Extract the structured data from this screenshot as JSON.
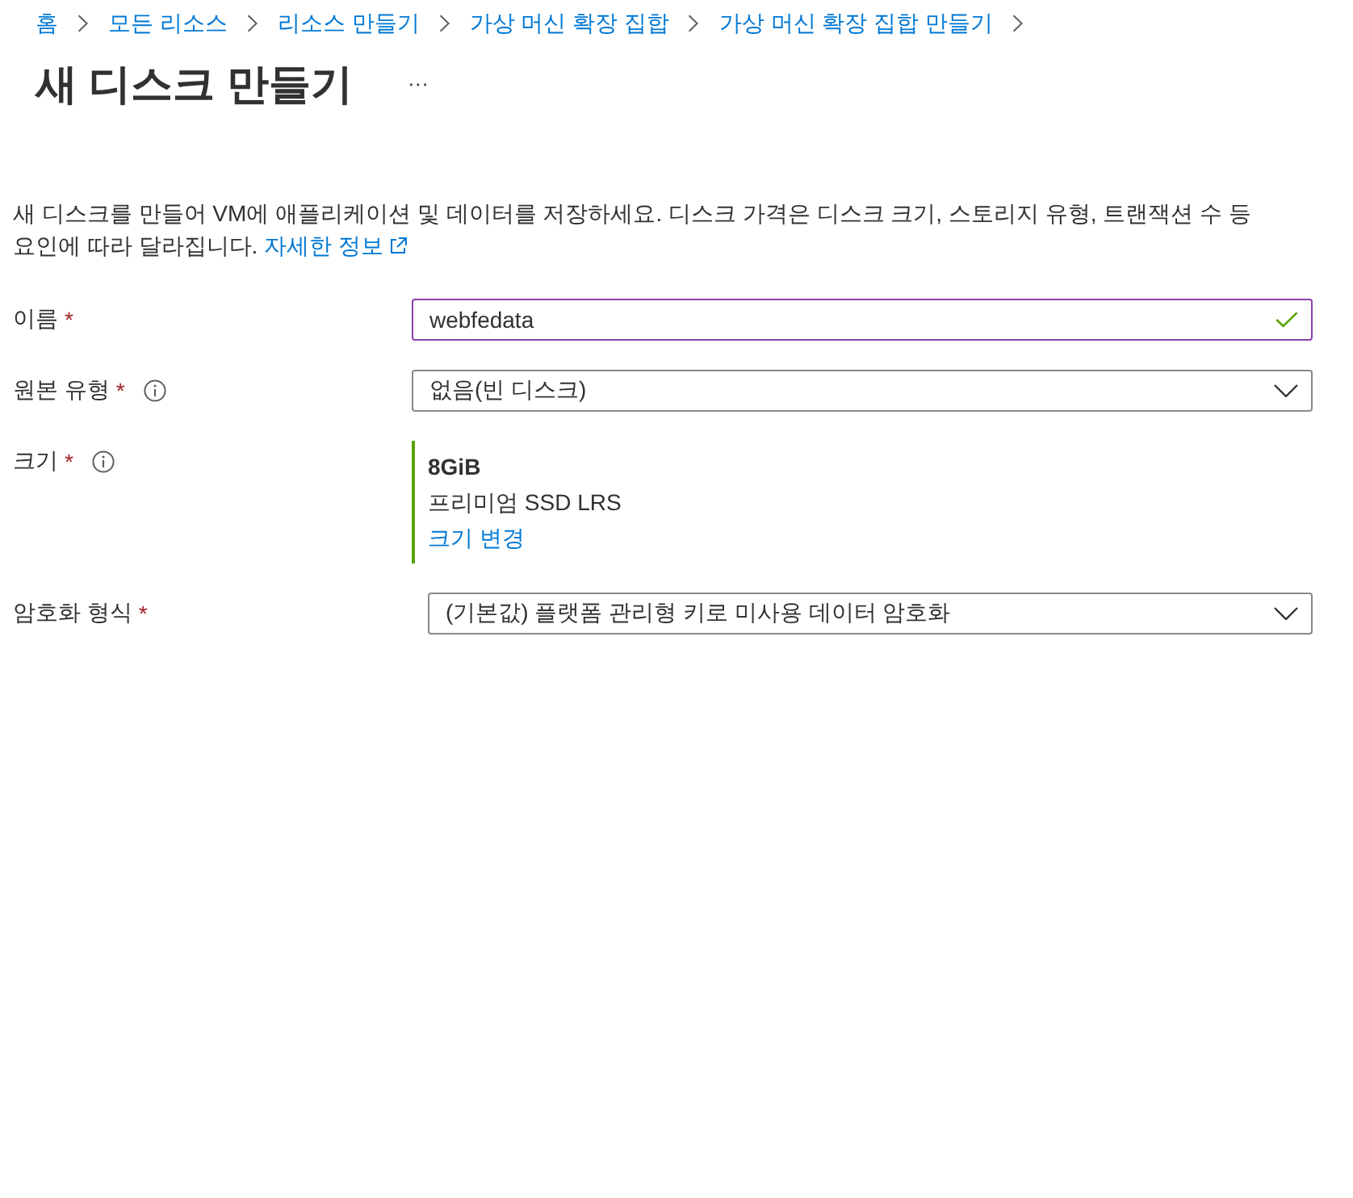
{
  "breadcrumb": [
    {
      "label": "홈"
    },
    {
      "label": "모든 리소스"
    },
    {
      "label": "리소스 만들기"
    },
    {
      "label": "가상 머신 확장 집합"
    },
    {
      "label": "가상 머신 확장 집합 만들기"
    }
  ],
  "title": "새 디스크 만들기",
  "more_button": "···",
  "description": {
    "text": "새 디스크를 만들어 VM에 애플리케이션 및 데이터를 저장하세요. 디스크 가격은 디스크 크기, 스토리지 유형, 트랜잭션 수 등 요인에 따라 달라집니다.",
    "link": "자세한 정보"
  },
  "fields": [
    {
      "kind": "text",
      "label": "이름",
      "required_mark": "*",
      "value": "webfedata",
      "focused": true,
      "valid": true
    },
    {
      "kind": "dropdown",
      "label": "원본 유형",
      "required_mark": "*",
      "info": true,
      "value": "없음(빈 디스크)"
    },
    {
      "kind": "size",
      "label": "크기",
      "required_mark": "*",
      "info": true,
      "size": "8GiB",
      "tier": "프리미엄 SSD LRS",
      "link": "크기 변경"
    },
    {
      "kind": "dropdown",
      "label": "암호화 형식",
      "required_mark": "*",
      "value": "(기본값) 플랫폼 관리형 키로 미사용 데이터 암호화"
    }
  ]
}
